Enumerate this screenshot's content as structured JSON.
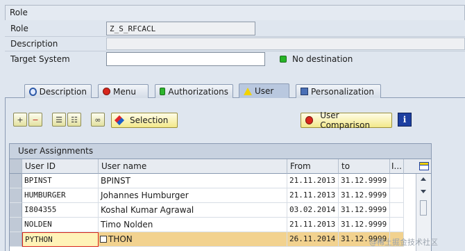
{
  "role_group": {
    "title": "Role",
    "fields": {
      "role_label": "Role",
      "role_value": "Z_S_RFCACL",
      "description_label": "Description",
      "description_value": "",
      "target_system_label": "Target System",
      "target_system_value": "",
      "destination_status": "No destination"
    }
  },
  "tabs": [
    {
      "label": "Description",
      "icon": "magnifier-icon"
    },
    {
      "label": "Menu",
      "icon": "red-circle-icon"
    },
    {
      "label": "Authorizations",
      "icon": "green-square-icon"
    },
    {
      "label": "User",
      "icon": "yellow-triangle-icon",
      "active": true
    },
    {
      "label": "Personalization",
      "icon": "personalization-icon"
    }
  ],
  "toolbar": {
    "selection_label": "Selection",
    "user_comparison_label": "User Comparison",
    "info_label": "i"
  },
  "table": {
    "title": "User Assignments",
    "columns": [
      "User ID",
      "User name",
      "From",
      "to",
      "I..."
    ],
    "rows": [
      {
        "user_id": "BPINST",
        "user_name": "BPINST",
        "from": "21.11.2013",
        "to": "31.12.9999"
      },
      {
        "user_id": "HUMBURGER",
        "user_name": "Johannes Humburger",
        "from": "21.11.2013",
        "to": "31.12.9999"
      },
      {
        "user_id": "I804355",
        "user_name": "Koshal Kumar Agrawal",
        "from": "03.02.2014",
        "to": "31.12.9999"
      },
      {
        "user_id": "NOLDEN",
        "user_name": "Timo Nolden",
        "from": "21.11.2013",
        "to": "31.12.9999"
      },
      {
        "user_id": "PYTHON",
        "user_name": "THON",
        "from": "26.11.2014",
        "to": "31.12.9999"
      }
    ]
  },
  "watermark": "@稀土掘金技术社区",
  "colors": {
    "background": "#dfe6ef",
    "selected_row": "#f2d28f",
    "accent_blue": "#1d3fa0",
    "status_green": "#2db52d"
  }
}
